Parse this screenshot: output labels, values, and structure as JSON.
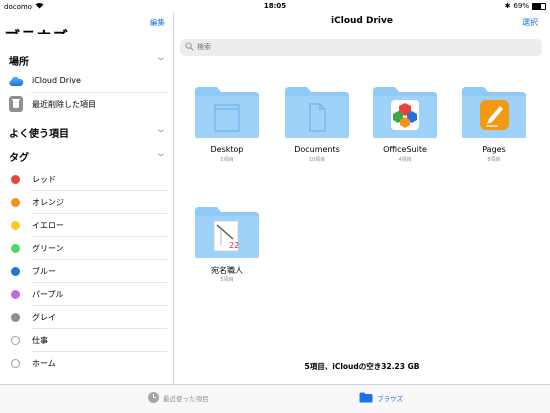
{
  "status_bar": {
    "carrier": "docomo",
    "time": "18:05",
    "battery": "69%"
  },
  "sidebar": {
    "edit_label": "編集",
    "title": "ブラウズ",
    "locations": {
      "header": "場所",
      "items": [
        {
          "label": "iCloud Drive",
          "icon": "icloud-icon"
        },
        {
          "label": "最近削除した項目",
          "icon": "trash-icon"
        }
      ]
    },
    "favorites": {
      "header": "よく使う項目"
    },
    "tags": {
      "header": "タグ",
      "items": [
        {
          "label": "レッド",
          "color": "#e8453c"
        },
        {
          "label": "オレンジ",
          "color": "#f5901e"
        },
        {
          "label": "イエロー",
          "color": "#f7cd22"
        },
        {
          "label": "グリーン",
          "color": "#4cd964"
        },
        {
          "label": "ブルー",
          "color": "#1976e4"
        },
        {
          "label": "パープル",
          "color": "#c467e1"
        },
        {
          "label": "グレイ",
          "color": "#8e8e93"
        },
        {
          "label": "仕事",
          "color": ""
        },
        {
          "label": "ホーム",
          "color": ""
        }
      ]
    }
  },
  "main": {
    "title": "iCloud Drive",
    "select_label": "選択",
    "search_placeholder": "検索",
    "folders": [
      {
        "name": "Desktop",
        "count": "5項目",
        "icon": "desktop-folder-icon"
      },
      {
        "name": "Documents",
        "count": "10項目",
        "icon": "documents-folder-icon"
      },
      {
        "name": "OfficeSuite",
        "count": "4項目",
        "icon": "officesuite-app-icon"
      },
      {
        "name": "Pages",
        "count": "8項目",
        "icon": "pages-app-icon"
      },
      {
        "name": "宛名職人",
        "count": "5項目",
        "icon": "atena-app-icon"
      }
    ],
    "storage_text": "5項目、iCloudの空き32.23 GB"
  },
  "tab_bar": {
    "recent_label": "最近使った項目",
    "browse_label": "ブラウズ"
  },
  "colors": {
    "accent": "#1a73e8",
    "folder": "#8fc9f6"
  }
}
